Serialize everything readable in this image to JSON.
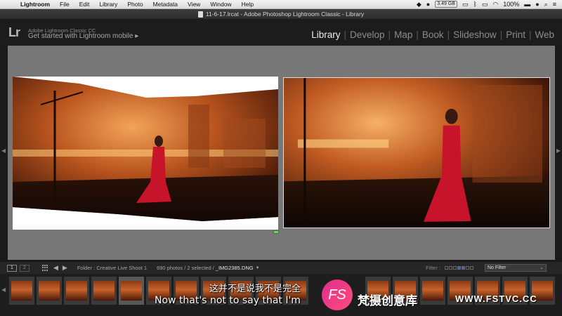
{
  "menubar": {
    "items": [
      "Lightroom",
      "File",
      "Edit",
      "Library",
      "Photo",
      "Metadata",
      "View",
      "Window",
      "Help"
    ],
    "memory": "3.49 GB",
    "battery": "100%"
  },
  "window": {
    "title": "11-6-17.lrcat - Adobe Photoshop Lightroom Classic - Library"
  },
  "identity": {
    "logo": "Lr",
    "line1": "Adobe Lightroom Classic CC",
    "line2": "Get started with Lightroom mobile  ▸"
  },
  "modules": [
    "Library",
    "Develop",
    "Map",
    "Book",
    "Slideshow",
    "Print",
    "Web"
  ],
  "active_module": "Library",
  "film_toolbar": {
    "page1": "1",
    "page2": "2",
    "source": "Folder : Creative Live Shoot 1",
    "count": "690 photos / 2 selected /",
    "filename": "_IMG2385.DNG",
    "filter_label": "Filter :",
    "filter_value": "No Filter"
  },
  "overlay": {
    "subtitle_cn": "这并不是说我不是完全",
    "subtitle_en": "Now that's not to say that I'm",
    "watermark_logo": "FS",
    "watermark_text": "梵摄创意库",
    "watermark_url": "WWW.FSTVC.CC"
  },
  "colors": {
    "panel_bg": "#777777",
    "accent_dress": "#c8142a",
    "stage_glow": "#e08a3a"
  }
}
